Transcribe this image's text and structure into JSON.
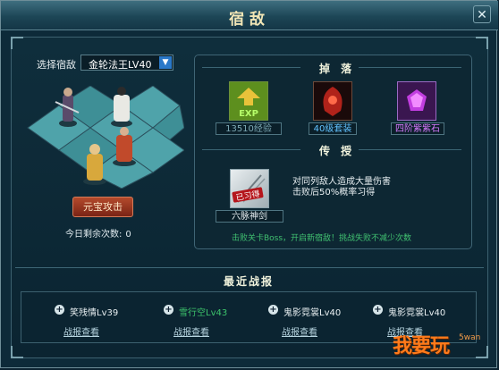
{
  "window": {
    "title": "宿敌",
    "close_icon": "close-icon"
  },
  "left": {
    "select_label": "选择宿敌",
    "selected_enemy": "金轮法王LV40",
    "attack_button": "元宝攻击",
    "remaining_label": "今日剩余次数:",
    "remaining_count": "0"
  },
  "drops": {
    "title": "掉 落",
    "items": [
      {
        "label": "13510经验",
        "color": "#7ea9b5",
        "icon": "exp-icon"
      },
      {
        "label": "40级套装",
        "color": "#62c2ff",
        "icon": "armor-icon"
      },
      {
        "label": "四阶紫紫石",
        "color": "#d77bff",
        "icon": "purple-gem-icon"
      }
    ]
  },
  "teach": {
    "title": "传 授",
    "skill_name": "六脉神剑",
    "stamp": "已习得",
    "desc_line1": "对同列敌人造成大量伤害",
    "desc_line2": "击败后50%概率习得",
    "tip": "击败关卡Boss，开启新宿敌！挑战失败不减少次数"
  },
  "records": {
    "title": "最近战报",
    "items": [
      {
        "name": "笑残情Lv39",
        "color": "#e9f0f2",
        "link": "战报查看"
      },
      {
        "name": "雪行空Lv43",
        "color": "#3cc36b",
        "link": "战报查看"
      },
      {
        "name": "鬼影霓裳Lv40",
        "color": "#e9f0f2",
        "link": "战报查看"
      },
      {
        "name": "鬼影霓裳Lv40",
        "color": "#e9f0f2",
        "link": "战报查看"
      }
    ]
  },
  "watermark": {
    "text": "我要玩",
    "sub": "5wan"
  }
}
